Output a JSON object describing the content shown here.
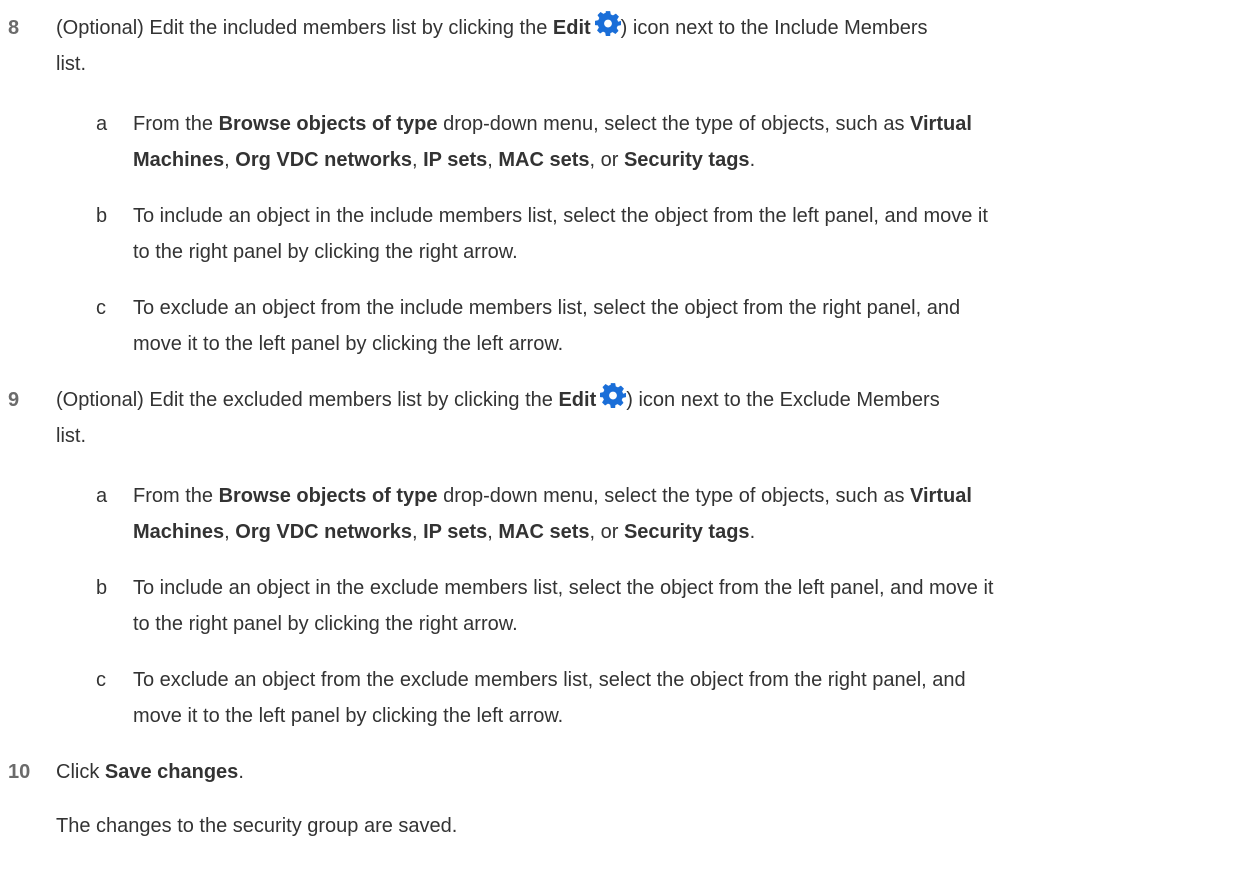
{
  "colors": {
    "text": "#333333",
    "step_number": "#6b6b6b",
    "gear_icon": "#1a6ed8"
  },
  "steps": [
    {
      "number": "8",
      "line1": {
        "t1": "(Optional) Edit the included members list by clicking the ",
        "b1": "Edit",
        "t2": ") icon next to the Include Members"
      },
      "line2": "list.",
      "icon": "gear-icon",
      "substeps": [
        {
          "letter": "a",
          "l1": {
            "t1": "From the ",
            "b1": "Browse objects of type",
            "t2": " drop-down menu, select the type of objects, such as ",
            "b2": "Virtual"
          },
          "l2": {
            "b1": "Machines",
            "t1": ", ",
            "b2": "Org VDC networks",
            "t2": ", ",
            "b3": "IP sets",
            "t3": ", ",
            "b4": "MAC sets",
            "t4": ", or ",
            "b5": "Security tags",
            "t5": "."
          }
        },
        {
          "letter": "b",
          "l1": "To include an object in the include members list, select the object from the left panel, and move it",
          "l2": "to the right panel by clicking the right arrow."
        },
        {
          "letter": "c",
          "l1": "To exclude an object from the include members list, select the object from the right panel, and",
          "l2": "move it to the left panel by clicking the left arrow."
        }
      ]
    },
    {
      "number": "9",
      "line1": {
        "t1": "(Optional) Edit the excluded members list by clicking the ",
        "b1": "Edit",
        "t2": ") icon next to the Exclude Members"
      },
      "line2": "list.",
      "icon": "gear-icon",
      "substeps": [
        {
          "letter": "a",
          "l1": {
            "t1": "From the ",
            "b1": "Browse objects of type",
            "t2": " drop-down menu, select the type of objects, such as ",
            "b2": "Virtual"
          },
          "l2": {
            "b1": "Machines",
            "t1": ", ",
            "b2": "Org VDC networks",
            "t2": ", ",
            "b3": "IP sets",
            "t3": ", ",
            "b4": "MAC sets",
            "t4": ", or ",
            "b5": "Security tags",
            "t5": "."
          }
        },
        {
          "letter": "b",
          "l1": "To include an object in the exclude members list, select the object from the left panel, and move it",
          "l2": "to the right panel by clicking the right arrow."
        },
        {
          "letter": "c",
          "l1": "To exclude an object from the exclude members list, select the object from the right panel, and",
          "l2": "move it to the left panel by clicking the left arrow."
        }
      ]
    },
    {
      "number": "10",
      "line1": {
        "t1": "Click ",
        "b1": "Save changes",
        "t2": "."
      },
      "result": "The changes to the security group are saved."
    }
  ]
}
